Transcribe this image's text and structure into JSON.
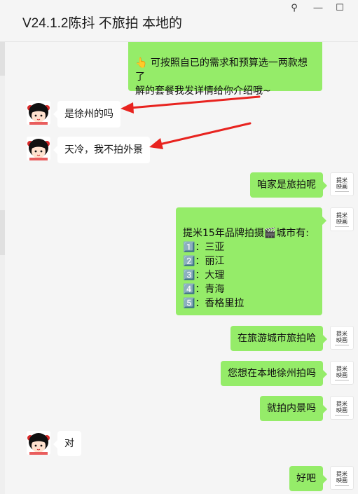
{
  "window": {
    "title": "V24.1.2陈抖 不旅拍 本地的",
    "pin_icon": "pin-icon",
    "min_icon": "minimize-icon",
    "max_icon": "maximize-icon",
    "pin_glyph": "⚲",
    "min_glyph": "—",
    "max_glyph": "☐"
  },
  "brand_logo": {
    "text": "提米\n映画"
  },
  "messages": [
    {
      "side": "out",
      "text": "👆 可按照自已的需求和预算选一两款想了\n解的套餐我发详情给你介绍哦~"
    },
    {
      "side": "in",
      "text": "是徐州的吗"
    },
    {
      "side": "in",
      "text": "天冷，我不拍外景"
    },
    {
      "side": "out",
      "text": "咱家是旅拍呢"
    },
    {
      "side": "out",
      "text": "提米15年品牌拍摄🎬城市有:\n1️⃣：三亚\n2️⃣：丽江\n3️⃣：大理\n4️⃣：青海\n5️⃣：香格里拉"
    },
    {
      "side": "out",
      "text": "在旅游城市旅拍哈"
    },
    {
      "side": "out",
      "text": "您想在本地徐州拍吗"
    },
    {
      "side": "out",
      "text": "就拍内景吗"
    },
    {
      "side": "in",
      "text": "对"
    },
    {
      "side": "out",
      "text": "好吧"
    }
  ],
  "colors": {
    "outgoing": "#95ec69",
    "incoming": "#ffffff",
    "arrow": "#e8231f",
    "background": "#f5f5f5"
  }
}
